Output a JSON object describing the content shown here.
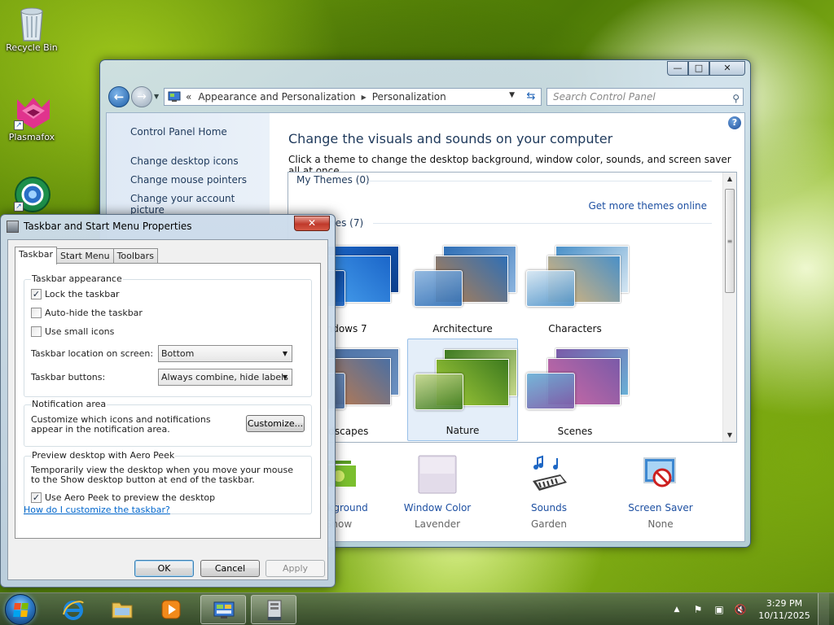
{
  "desktop": {
    "icons": [
      {
        "label": "Recycle Bin"
      },
      {
        "label": "Plasmafox"
      },
      {
        "label": ""
      }
    ]
  },
  "control_panel": {
    "breadcrumb": {
      "prefix": "«",
      "items": [
        "Appearance and Personalization",
        "Personalization"
      ]
    },
    "search_placeholder": "Search Control Panel",
    "left_links": {
      "home": "Control Panel Home",
      "desktop_icons": "Change desktop icons",
      "mouse_pointers": "Change mouse pointers",
      "account_picture": "Change your account picture"
    },
    "title": "Change the visuals and sounds on your computer",
    "description": "Click a theme to change the desktop background, window color, sounds, and screen saver all at once.",
    "my_themes": "My Themes (0)",
    "get_more": "Get more themes online",
    "aero_group": "mes (7)",
    "themes": [
      {
        "name": "indows 7",
        "colors": [
          "#1b66c9",
          "#4aa3ef",
          "#0c3f8c"
        ]
      },
      {
        "name": "Architecture",
        "colors": [
          "#2f6fb6",
          "#b87f4b",
          "#8cb4de"
        ]
      },
      {
        "name": "Characters",
        "colors": [
          "#4a90c8",
          "#e6b873",
          "#d5e6f2"
        ]
      },
      {
        "name": "ndscapes",
        "colors": [
          "#4b6fa3",
          "#c87b45",
          "#6b91c1"
        ]
      },
      {
        "name": "Nature",
        "colors": [
          "#3d7a1f",
          "#a7cf3a",
          "#c6d88c"
        ],
        "selected": true
      },
      {
        "name": "Scenes",
        "colors": [
          "#7a5aa8",
          "#d16aa4",
          "#6ab0d6"
        ]
      }
    ],
    "bottom": {
      "background": {
        "label": "Background",
        "sub": "Show"
      },
      "window_color": {
        "label": "Window Color",
        "sub": "Lavender"
      },
      "sounds": {
        "label": "Sounds",
        "sub": "Garden"
      },
      "screen_saver": {
        "label": "Screen Saver",
        "sub": "None"
      }
    },
    "caption_buttons": {
      "minimize": "—",
      "maximize": "□",
      "close": "✕"
    }
  },
  "dialog": {
    "title": "Taskbar and Start Menu Properties",
    "close": "✕",
    "tabs": [
      "Taskbar",
      "Start Menu",
      "Toolbars"
    ],
    "appearance": {
      "title": "Taskbar appearance",
      "lock": {
        "label": "Lock the taskbar",
        "checked": true
      },
      "autohide": {
        "label": "Auto-hide the taskbar",
        "checked": false
      },
      "small_icons": {
        "label": "Use small icons",
        "checked": false
      },
      "location_label": "Taskbar location on screen:",
      "location_value": "Bottom",
      "buttons_label": "Taskbar buttons:",
      "buttons_value": "Always combine, hide labels"
    },
    "notification": {
      "title": "Notification area",
      "text": "Customize which icons and notifications appear in the notification area.",
      "customize": "Customize..."
    },
    "aero_peek": {
      "title": "Preview desktop with Aero Peek",
      "text": "Temporarily view the desktop when you move your mouse to the Show desktop button at end of the taskbar.",
      "checkbox": {
        "label": "Use Aero Peek to preview the desktop",
        "checked": true
      }
    },
    "help_link": "How do I customize the taskbar?",
    "ok": "OK",
    "cancel": "Cancel",
    "apply": "Apply"
  },
  "taskbar": {
    "clock_time": "3:29 PM",
    "clock_date": "10/11/2025",
    "tray_chevron": "▲"
  }
}
